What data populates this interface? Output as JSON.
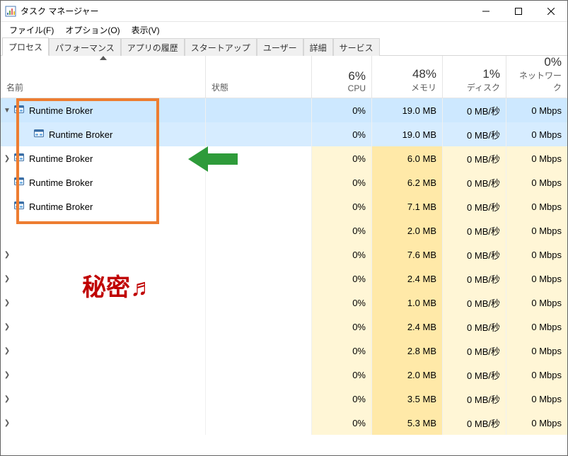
{
  "window": {
    "title": "タスク マネージャー"
  },
  "menu": {
    "file": "ファイル(F)",
    "options": "オプション(O)",
    "view": "表示(V)"
  },
  "tabs": {
    "processes": "プロセス",
    "performance": "パフォーマンス",
    "app_history": "アプリの履歴",
    "startup": "スタートアップ",
    "users": "ユーザー",
    "details": "詳細",
    "services": "サービス"
  },
  "columns": {
    "name": "名前",
    "status": "状態",
    "cpu_pct": "6%",
    "cpu_label": "CPU",
    "mem_pct": "48%",
    "mem_label": "メモリ",
    "disk_pct": "1%",
    "disk_label": "ディスク",
    "net_pct": "0%",
    "net_label": "ネットワーク"
  },
  "rows": [
    {
      "sel": true,
      "exp": "v",
      "ind": 0,
      "name": "Runtime Broker",
      "cpu": "0%",
      "mem": "19.0 MB",
      "disk": "0 MB/秒",
      "net": "0 Mbps"
    },
    {
      "sel": true,
      "exp": "",
      "ind": 1,
      "name": "Runtime Broker",
      "cpu": "0%",
      "mem": "19.0 MB",
      "disk": "0 MB/秒",
      "net": "0 Mbps"
    },
    {
      "sel": false,
      "exp": ">",
      "ind": 0,
      "name": "Runtime Broker",
      "cpu": "0%",
      "mem": "6.0 MB",
      "disk": "0 MB/秒",
      "net": "0 Mbps"
    },
    {
      "sel": false,
      "exp": "",
      "ind": 0,
      "name": "Runtime Broker",
      "cpu": "0%",
      "mem": "6.2 MB",
      "disk": "0 MB/秒",
      "net": "0 Mbps"
    },
    {
      "sel": false,
      "exp": "",
      "ind": 0,
      "name": "Runtime Broker",
      "cpu": "0%",
      "mem": "7.1 MB",
      "disk": "0 MB/秒",
      "net": "0 Mbps"
    },
    {
      "sel": false,
      "exp": "",
      "ind": -1,
      "name": "",
      "cpu": "0%",
      "mem": "2.0 MB",
      "disk": "0 MB/秒",
      "net": "0 Mbps"
    },
    {
      "sel": false,
      "exp": ">",
      "ind": -1,
      "name": "",
      "cpu": "0%",
      "mem": "7.6 MB",
      "disk": "0 MB/秒",
      "net": "0 Mbps"
    },
    {
      "sel": false,
      "exp": ">",
      "ind": -1,
      "name": "",
      "cpu": "0%",
      "mem": "2.4 MB",
      "disk": "0 MB/秒",
      "net": "0 Mbps"
    },
    {
      "sel": false,
      "exp": ">",
      "ind": -1,
      "name": "",
      "cpu": "0%",
      "mem": "1.0 MB",
      "disk": "0 MB/秒",
      "net": "0 Mbps"
    },
    {
      "sel": false,
      "exp": ">",
      "ind": -1,
      "name": "",
      "cpu": "0%",
      "mem": "2.4 MB",
      "disk": "0 MB/秒",
      "net": "0 Mbps"
    },
    {
      "sel": false,
      "exp": ">",
      "ind": -1,
      "name": "",
      "cpu": "0%",
      "mem": "2.8 MB",
      "disk": "0 MB/秒",
      "net": "0 Mbps"
    },
    {
      "sel": false,
      "exp": ">",
      "ind": -1,
      "name": "",
      "cpu": "0%",
      "mem": "2.0 MB",
      "disk": "0 MB/秒",
      "net": "0 Mbps"
    },
    {
      "sel": false,
      "exp": ">",
      "ind": -1,
      "name": "",
      "cpu": "0%",
      "mem": "3.5 MB",
      "disk": "0 MB/秒",
      "net": "0 Mbps"
    },
    {
      "sel": false,
      "exp": ">",
      "ind": -1,
      "name": "",
      "cpu": "0%",
      "mem": "5.3 MB",
      "disk": "0 MB/秒",
      "net": "0 Mbps"
    }
  ],
  "overlay": {
    "secret": "秘密♬"
  }
}
